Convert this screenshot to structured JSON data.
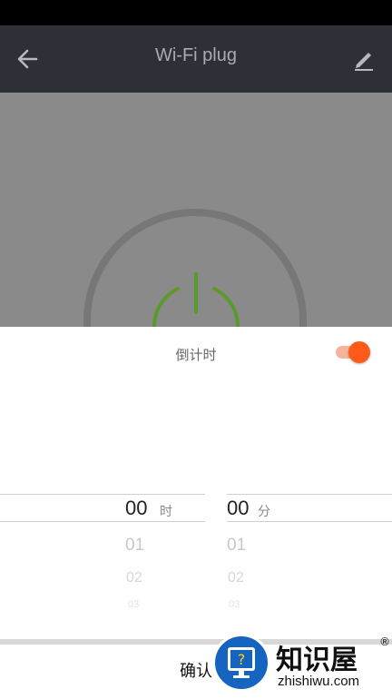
{
  "app_bar": {
    "title": "Wi-Fi plug",
    "back_icon": "arrow-left-icon",
    "edit_icon": "pencil-icon"
  },
  "device": {
    "power_icon": "power-icon",
    "power_color": "#5a9a2a"
  },
  "timer": {
    "label": "倒计时",
    "enabled": true,
    "accent": "#ff5a1a"
  },
  "hour_picker": {
    "selected": "00",
    "unit": "时",
    "next": [
      "01",
      "02",
      "03"
    ]
  },
  "minute_picker": {
    "selected": "00",
    "unit": "分",
    "next": [
      "01",
      "02",
      "03"
    ]
  },
  "confirm_label": "确认",
  "watermark": {
    "brand": "知识屋",
    "url": "zhishiwu.com",
    "reg": "®"
  }
}
